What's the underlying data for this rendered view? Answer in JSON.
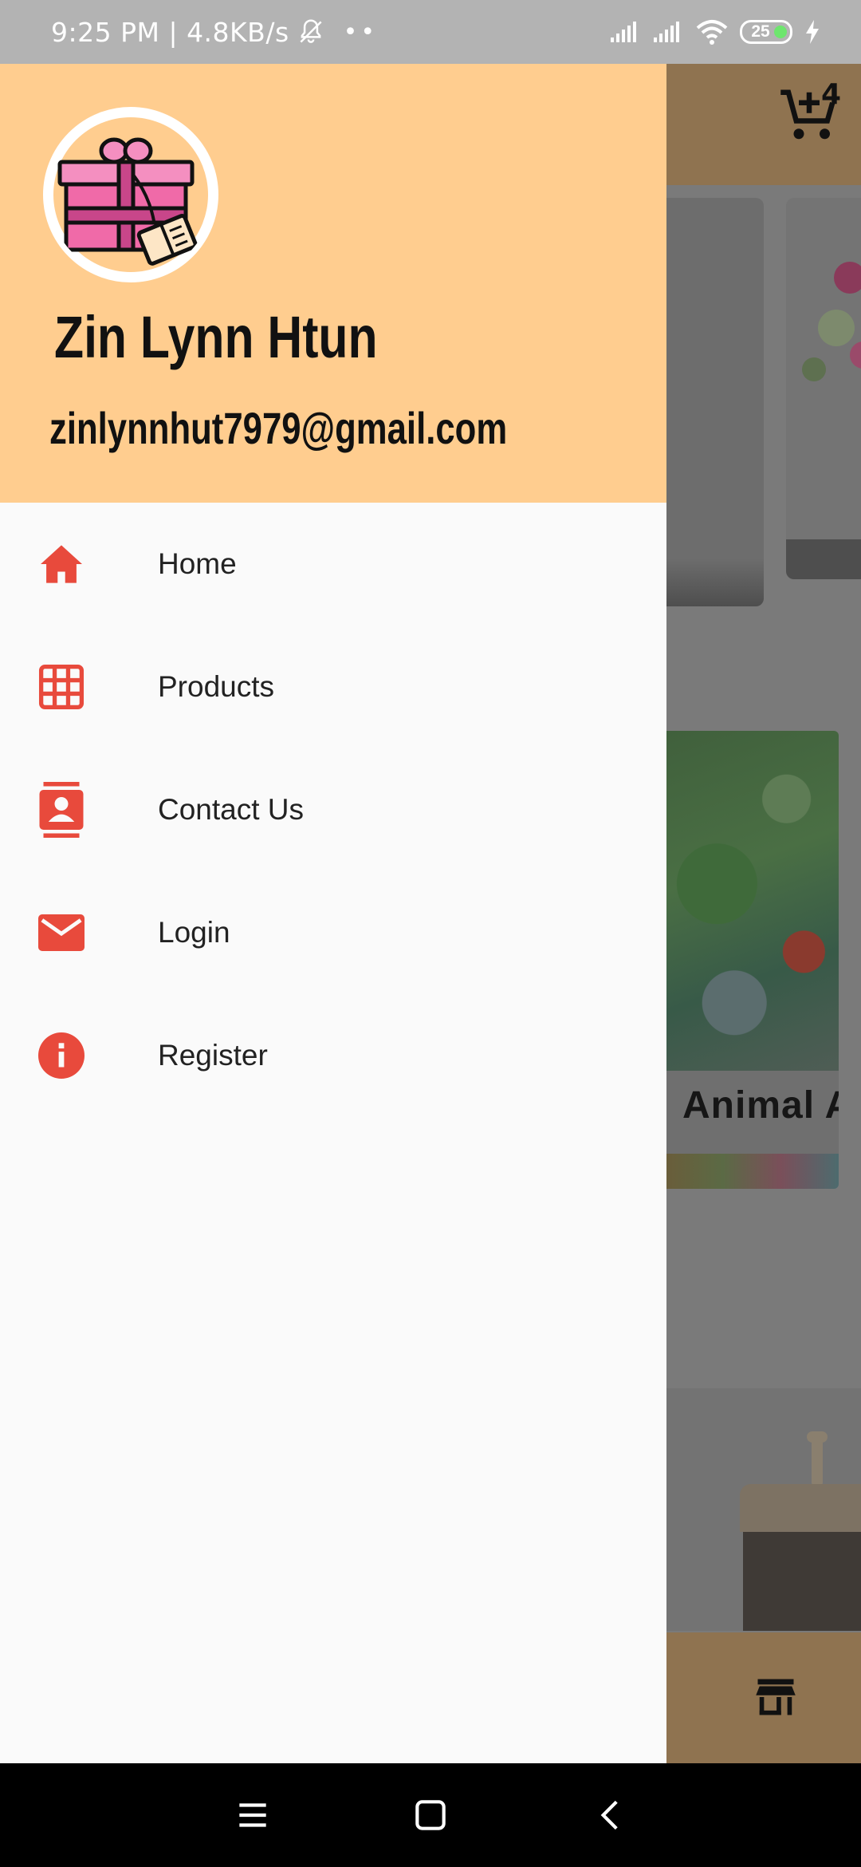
{
  "status_bar": {
    "time_speed": "9:25 PM | 4.8KB/s",
    "dots": "••",
    "battery_level": "25"
  },
  "background_app": {
    "cart_count": "4",
    "card_label": "Animal Art"
  },
  "drawer": {
    "user_name": "Zin Lynn Htun",
    "user_email": "zinlynnhut7979@gmail.com",
    "menu": [
      {
        "label": "Home",
        "icon": "home-icon"
      },
      {
        "label": "Products",
        "icon": "grid-icon"
      },
      {
        "label": "Contact Us",
        "icon": "contacts-icon"
      },
      {
        "label": "Login",
        "icon": "mail-icon"
      },
      {
        "label": "Register",
        "icon": "info-icon"
      }
    ]
  },
  "colors": {
    "header_bg": "#ffcd8f",
    "icon_red": "#e84a3c",
    "drawer_bg": "#fafafa"
  }
}
